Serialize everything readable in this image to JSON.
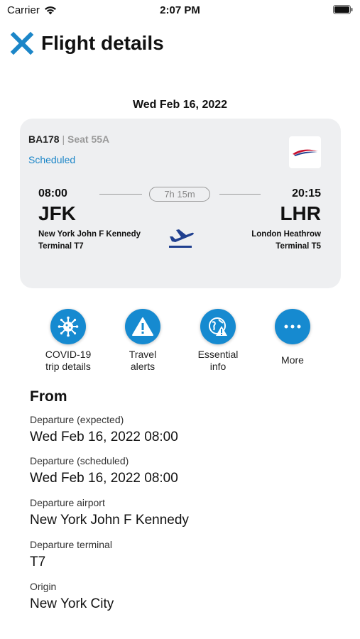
{
  "status_bar": {
    "carrier": "Carrier",
    "time": "2:07 PM"
  },
  "header": {
    "title": "Flight details",
    "close_icon": "close-icon",
    "accent": "#1c86c8"
  },
  "date_heading": "Wed Feb 16, 2022",
  "flight": {
    "number": "BA178",
    "separator": "|",
    "seat": "Seat 55A",
    "status": "Scheduled",
    "airline_logo": "british-airways-logo",
    "duration": "7h 15m",
    "departure": {
      "time": "08:00",
      "code": "JFK",
      "airport": "New York John F Kennedy",
      "terminal": "Terminal T7"
    },
    "arrival": {
      "time": "20:15",
      "code": "LHR",
      "airport": "London Heathrow",
      "terminal": "Terminal T5"
    }
  },
  "actions": [
    {
      "line1": "COVID-19",
      "line2": "trip details",
      "icon": "virus-icon"
    },
    {
      "line1": "Travel",
      "line2": "alerts",
      "icon": "warning-icon"
    },
    {
      "line1": "Essential",
      "line2": "info",
      "icon": "globe-info-icon"
    },
    {
      "line1": "More",
      "icon": "more-icon"
    }
  ],
  "from_section": {
    "title": "From",
    "fields": [
      {
        "label": "Departure (expected)",
        "value": "Wed Feb 16, 2022 08:00"
      },
      {
        "label": "Departure (scheduled)",
        "value": "Wed Feb 16, 2022 08:00"
      },
      {
        "label": "Departure airport",
        "value": "New York John F Kennedy"
      },
      {
        "label": "Departure terminal",
        "value": "T7"
      },
      {
        "label": "Origin",
        "value": "New York City"
      }
    ]
  }
}
